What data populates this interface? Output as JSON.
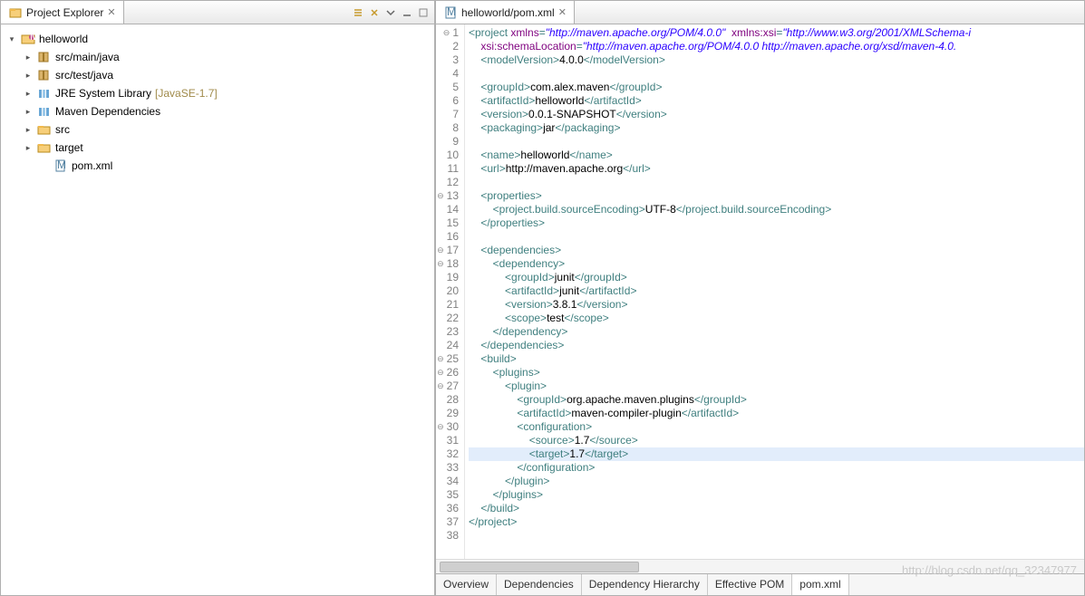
{
  "left": {
    "title": "Project Explorer",
    "toolbar": [
      "collapse",
      "link",
      "menu",
      "min",
      "max"
    ],
    "tree": [
      {
        "d": 0,
        "exp": "▾",
        "icon": "proj",
        "label": "helloworld"
      },
      {
        "d": 1,
        "exp": "▸",
        "icon": "pkg",
        "label": "src/main/java"
      },
      {
        "d": 1,
        "exp": "▸",
        "icon": "pkg",
        "label": "src/test/java"
      },
      {
        "d": 1,
        "exp": "▸",
        "icon": "lib",
        "label": "JRE System Library",
        "suffix": "[JavaSE-1.7]"
      },
      {
        "d": 1,
        "exp": "▸",
        "icon": "lib",
        "label": "Maven Dependencies"
      },
      {
        "d": 1,
        "exp": "▸",
        "icon": "fld",
        "label": "src"
      },
      {
        "d": 1,
        "exp": "▸",
        "icon": "fld",
        "label": "target"
      },
      {
        "d": 2,
        "exp": "",
        "icon": "xml",
        "label": "pom.xml"
      }
    ]
  },
  "right": {
    "tab": "helloworld/pom.xml",
    "highlight_line": 32,
    "bottom_tabs": [
      "Overview",
      "Dependencies",
      "Dependency Hierarchy",
      "Effective POM",
      "pom.xml"
    ],
    "bottom_selected": 4,
    "watermark": "http://blog.csdn.net/qq_32347977",
    "lines": [
      {
        "n": 1,
        "fold": "⊖",
        "seg": [
          [
            "tag",
            "<project "
          ],
          [
            "attr",
            "xmlns"
          ],
          [
            "tag",
            "="
          ],
          [
            "str",
            "\"http://maven.apache.org/POM/4.0.0\""
          ],
          [
            "txt",
            "  "
          ],
          [
            "attr",
            "xmlns:xsi"
          ],
          [
            "tag",
            "="
          ],
          [
            "str",
            "\"http://www.w3.org/2001/XMLSchema-i"
          ]
        ]
      },
      {
        "n": 2,
        "seg": [
          [
            "txt",
            "    "
          ],
          [
            "attr",
            "xsi:schemaLocation"
          ],
          [
            "tag",
            "="
          ],
          [
            "str",
            "\"http://maven.apache.org/POM/4.0.0 http://maven.apache.org/xsd/maven-4.0."
          ]
        ]
      },
      {
        "n": 3,
        "seg": [
          [
            "txt",
            "    "
          ],
          [
            "tag",
            "<modelVersion>"
          ],
          [
            "txt",
            "4.0.0"
          ],
          [
            "tag",
            "</modelVersion>"
          ]
        ]
      },
      {
        "n": 4,
        "seg": [
          [
            "txt",
            ""
          ]
        ]
      },
      {
        "n": 5,
        "seg": [
          [
            "txt",
            "    "
          ],
          [
            "tag",
            "<groupId>"
          ],
          [
            "txt",
            "com.alex.maven"
          ],
          [
            "tag",
            "</groupId>"
          ]
        ]
      },
      {
        "n": 6,
        "seg": [
          [
            "txt",
            "    "
          ],
          [
            "tag",
            "<artifactId>"
          ],
          [
            "txt",
            "helloworld"
          ],
          [
            "tag",
            "</artifactId>"
          ]
        ]
      },
      {
        "n": 7,
        "seg": [
          [
            "txt",
            "    "
          ],
          [
            "tag",
            "<version>"
          ],
          [
            "txt",
            "0.0.1-SNAPSHOT"
          ],
          [
            "tag",
            "</version>"
          ]
        ]
      },
      {
        "n": 8,
        "seg": [
          [
            "txt",
            "    "
          ],
          [
            "tag",
            "<packaging>"
          ],
          [
            "txt",
            "jar"
          ],
          [
            "tag",
            "</packaging>"
          ]
        ]
      },
      {
        "n": 9,
        "seg": [
          [
            "txt",
            ""
          ]
        ]
      },
      {
        "n": 10,
        "seg": [
          [
            "txt",
            "    "
          ],
          [
            "tag",
            "<name>"
          ],
          [
            "txt",
            "helloworld"
          ],
          [
            "tag",
            "</name>"
          ]
        ]
      },
      {
        "n": 11,
        "seg": [
          [
            "txt",
            "    "
          ],
          [
            "tag",
            "<url>"
          ],
          [
            "txt",
            "http://maven.apache.org"
          ],
          [
            "tag",
            "</url>"
          ]
        ]
      },
      {
        "n": 12,
        "seg": [
          [
            "txt",
            ""
          ]
        ]
      },
      {
        "n": 13,
        "fold": "⊖",
        "seg": [
          [
            "txt",
            "    "
          ],
          [
            "tag",
            "<properties>"
          ]
        ]
      },
      {
        "n": 14,
        "seg": [
          [
            "txt",
            "        "
          ],
          [
            "tag",
            "<project.build.sourceEncoding>"
          ],
          [
            "txt",
            "UTF-8"
          ],
          [
            "tag",
            "</project.build.sourceEncoding>"
          ]
        ]
      },
      {
        "n": 15,
        "seg": [
          [
            "txt",
            "    "
          ],
          [
            "tag",
            "</properties>"
          ]
        ]
      },
      {
        "n": 16,
        "seg": [
          [
            "txt",
            ""
          ]
        ]
      },
      {
        "n": 17,
        "fold": "⊖",
        "seg": [
          [
            "txt",
            "    "
          ],
          [
            "tag",
            "<dependencies>"
          ]
        ]
      },
      {
        "n": 18,
        "fold": "⊖",
        "seg": [
          [
            "txt",
            "        "
          ],
          [
            "tag",
            "<dependency>"
          ]
        ]
      },
      {
        "n": 19,
        "seg": [
          [
            "txt",
            "            "
          ],
          [
            "tag",
            "<groupId>"
          ],
          [
            "txt",
            "junit"
          ],
          [
            "tag",
            "</groupId>"
          ]
        ]
      },
      {
        "n": 20,
        "seg": [
          [
            "txt",
            "            "
          ],
          [
            "tag",
            "<artifactId>"
          ],
          [
            "txt",
            "junit"
          ],
          [
            "tag",
            "</artifactId>"
          ]
        ]
      },
      {
        "n": 21,
        "seg": [
          [
            "txt",
            "            "
          ],
          [
            "tag",
            "<version>"
          ],
          [
            "txt",
            "3.8.1"
          ],
          [
            "tag",
            "</version>"
          ]
        ]
      },
      {
        "n": 22,
        "seg": [
          [
            "txt",
            "            "
          ],
          [
            "tag",
            "<scope>"
          ],
          [
            "txt",
            "test"
          ],
          [
            "tag",
            "</scope>"
          ]
        ]
      },
      {
        "n": 23,
        "seg": [
          [
            "txt",
            "        "
          ],
          [
            "tag",
            "</dependency>"
          ]
        ]
      },
      {
        "n": 24,
        "seg": [
          [
            "txt",
            "    "
          ],
          [
            "tag",
            "</dependencies>"
          ]
        ]
      },
      {
        "n": 25,
        "fold": "⊖",
        "seg": [
          [
            "txt",
            "    "
          ],
          [
            "tag",
            "<build>"
          ]
        ]
      },
      {
        "n": 26,
        "fold": "⊖",
        "seg": [
          [
            "txt",
            "        "
          ],
          [
            "tag",
            "<plugins>"
          ]
        ]
      },
      {
        "n": 27,
        "fold": "⊖",
        "seg": [
          [
            "txt",
            "            "
          ],
          [
            "tag",
            "<plugin>"
          ]
        ]
      },
      {
        "n": 28,
        "seg": [
          [
            "txt",
            "                "
          ],
          [
            "tag",
            "<groupId>"
          ],
          [
            "txt",
            "org.apache.maven.plugins"
          ],
          [
            "tag",
            "</groupId>"
          ]
        ]
      },
      {
        "n": 29,
        "seg": [
          [
            "txt",
            "                "
          ],
          [
            "tag",
            "<artifactId>"
          ],
          [
            "txt",
            "maven-compiler-plugin"
          ],
          [
            "tag",
            "</artifactId>"
          ]
        ]
      },
      {
        "n": 30,
        "fold": "⊖",
        "seg": [
          [
            "txt",
            "                "
          ],
          [
            "tag",
            "<configuration>"
          ]
        ]
      },
      {
        "n": 31,
        "seg": [
          [
            "txt",
            "                    "
          ],
          [
            "tag",
            "<source>"
          ],
          [
            "txt",
            "1.7"
          ],
          [
            "tag",
            "</source>"
          ]
        ]
      },
      {
        "n": 32,
        "seg": [
          [
            "txt",
            "                    "
          ],
          [
            "tag",
            "<target>"
          ],
          [
            "txt",
            "1.7"
          ],
          [
            "tag",
            "</target>"
          ]
        ]
      },
      {
        "n": 33,
        "seg": [
          [
            "txt",
            "                "
          ],
          [
            "tag",
            "</configuration>"
          ]
        ]
      },
      {
        "n": 34,
        "seg": [
          [
            "txt",
            "            "
          ],
          [
            "tag",
            "</plugin>"
          ]
        ]
      },
      {
        "n": 35,
        "seg": [
          [
            "txt",
            "        "
          ],
          [
            "tag",
            "</plugins>"
          ]
        ]
      },
      {
        "n": 36,
        "seg": [
          [
            "txt",
            "    "
          ],
          [
            "tag",
            "</build>"
          ]
        ]
      },
      {
        "n": 37,
        "seg": [
          [
            "tag",
            "</project>"
          ]
        ]
      },
      {
        "n": 38,
        "seg": [
          [
            "txt",
            ""
          ]
        ]
      }
    ]
  }
}
